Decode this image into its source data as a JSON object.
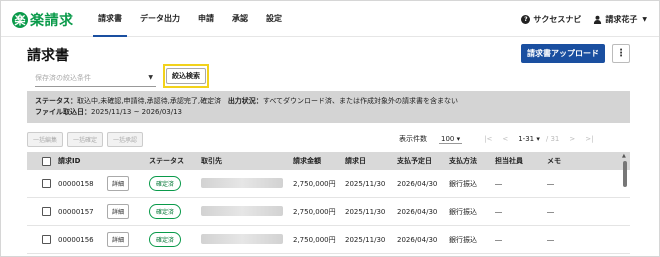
{
  "header": {
    "logo_mark": "楽",
    "logo_text": "楽請求",
    "nav": [
      {
        "label": "請求書",
        "active": true
      },
      {
        "label": "データ出力",
        "active": false
      },
      {
        "label": "申請",
        "active": false
      },
      {
        "label": "承認",
        "active": false
      },
      {
        "label": "設定",
        "active": false
      }
    ],
    "help_label": "サクセスナビ",
    "user_label": "請求花子"
  },
  "page": {
    "title": "請求書",
    "upload_button": "請求書アップロード",
    "more_button": "⋮"
  },
  "filter": {
    "saved_placeholder": "保存済の絞込条件",
    "search_button": "絞込検索",
    "status_label": "ステータス：",
    "status_value": "取込中,未確認,申請待,承認待,承認完了,確定済",
    "output_label": "出力状況：",
    "output_value": "すべてダウンロード済、または作成対象外の請求書を含まない",
    "import_label": "ファイル取込日：",
    "import_value": "2025/11/13 ~ 2026/03/13"
  },
  "bulk_actions": [
    "一括編集",
    "一括確定",
    "一括承認"
  ],
  "pager": {
    "per_page_label": "表示件数",
    "per_page_value": "100 ▾",
    "first": "|<",
    "prev": "<",
    "range": "1-31 ▾",
    "total": "/ 31",
    "next": ">",
    "last": ">|"
  },
  "table": {
    "columns": [
      "請求ID",
      "",
      "ステータス",
      "取引先",
      "請求金額",
      "請求日",
      "支払予定日",
      "支払方法",
      "担当社員",
      "メモ"
    ],
    "rows": [
      {
        "id": "00000158",
        "detail": "詳細",
        "status": "確定済",
        "amount": "2,750,000円",
        "date": "2025/11/30",
        "due": "2026/04/30",
        "method": "銀行振込",
        "staff": "―",
        "memo": "―"
      },
      {
        "id": "00000157",
        "detail": "詳細",
        "status": "確定済",
        "amount": "2,750,000円",
        "date": "2025/11/30",
        "due": "2026/04/30",
        "method": "銀行振込",
        "staff": "―",
        "memo": "―"
      },
      {
        "id": "00000156",
        "detail": "詳細",
        "status": "確定済",
        "amount": "2,750,000円",
        "date": "2025/11/30",
        "due": "2026/04/30",
        "method": "銀行振込",
        "staff": "―",
        "memo": "―"
      }
    ]
  },
  "colors": {
    "brand_green": "#0a9a4a",
    "primary_blue": "#1a4fa0",
    "highlight_yellow": "#f2d21c"
  }
}
